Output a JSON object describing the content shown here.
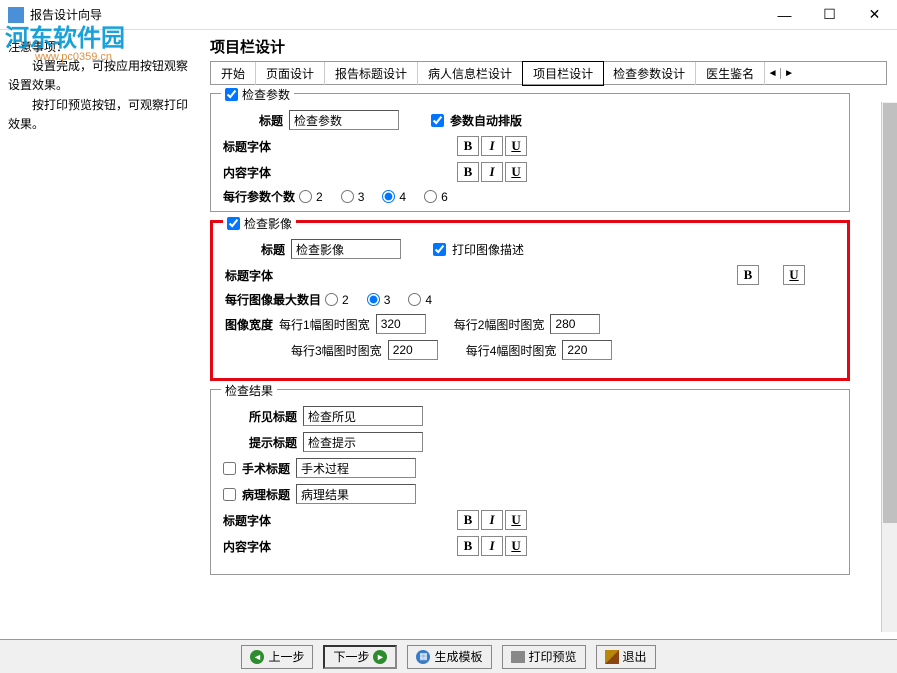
{
  "window": {
    "title": "报告设计向导",
    "minimize": "—",
    "maximize": "☐",
    "close": "✕"
  },
  "watermark": {
    "main": "河东软件园",
    "sub": "www.pc0359.cn"
  },
  "left_text": {
    "line1": "注意事项：",
    "line2": "设置完成，可按应用按钮观察设置效果。",
    "line3": "按打印预览按钮，可观察打印效果。"
  },
  "section_title": "项目栏设计",
  "tabs": {
    "items": [
      "开始",
      "页面设计",
      "报告标题设计",
      "病人信息栏设计",
      "项目栏设计",
      "检查参数设计",
      "医生鉴名"
    ],
    "active_index": 4,
    "arrow_left": "◄",
    "arrow_right": "►"
  },
  "group1": {
    "checkbox_label": "检查参数",
    "title_label": "标题",
    "title_value": "检查参数",
    "auto_layout": "参数自动排版",
    "title_font": "标题字体",
    "content_font": "内容字体",
    "params_per_row": "每行参数个数",
    "radio_options": [
      "2",
      "3",
      "4",
      "6"
    ],
    "radio_selected": "4"
  },
  "group2": {
    "checkbox_label": "检查影像",
    "title_label": "标题",
    "title_value": "检查影像",
    "print_desc": "打印图像描述",
    "title_font": "标题字体",
    "max_images": "每行图像最大数目",
    "radio_options": [
      "2",
      "3",
      "4"
    ],
    "radio_selected": "3",
    "image_width": "图像宽度",
    "row1_lbl": "每行1幅图时图宽",
    "row1_val": "320",
    "row2_lbl": "每行2幅图时图宽",
    "row2_val": "280",
    "row3_lbl": "每行3幅图时图宽",
    "row3_val": "220",
    "row4_lbl": "每行4幅图时图宽",
    "row4_val": "220"
  },
  "group3": {
    "title": "检查结果",
    "finding_label": "所见标题",
    "finding_value": "检查所见",
    "hint_label": "提示标题",
    "hint_value": "检查提示",
    "surgery_label": "手术标题",
    "surgery_value": "手术过程",
    "pathology_label": "病理标题",
    "pathology_value": "病理结果",
    "title_font": "标题字体",
    "content_font": "内容字体"
  },
  "biu": {
    "b": "B",
    "i": "I",
    "u": "U"
  },
  "footer": {
    "prev": "上一步",
    "next": "下一步",
    "gen_template": "生成模板",
    "print_preview": "打印预览",
    "exit": "退出"
  }
}
